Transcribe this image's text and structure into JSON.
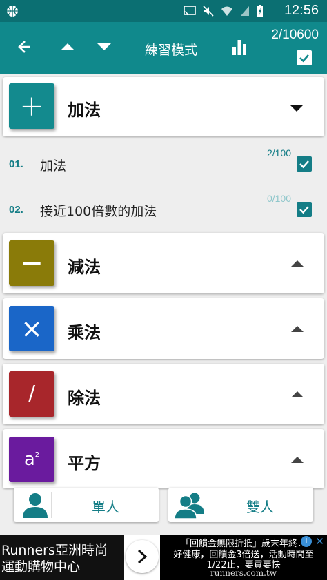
{
  "status_bar": {
    "time": "12:56",
    "icons": [
      "basketball-icon",
      "cast-icon",
      "mute-icon",
      "wifi-icon",
      "signal-icon",
      "battery-charging-icon"
    ]
  },
  "app_bar": {
    "title": "練習模式",
    "counter": "2/10600",
    "select_all_checked": true,
    "buttons": [
      "back-icon",
      "move-up-icon",
      "move-down-icon",
      "stats-icon"
    ]
  },
  "categories": [
    {
      "title": "加法",
      "symbol": "+",
      "color": "#138a8e",
      "expanded": true,
      "items": [
        {
          "num": "01.",
          "label": "加法",
          "progress": "2/100",
          "checked": true
        },
        {
          "num": "02.",
          "label": "接近100倍數的加法",
          "progress": "0/100",
          "checked": true
        }
      ]
    },
    {
      "title": "減法",
      "symbol": "−",
      "color": "#8a7b09",
      "expanded": false
    },
    {
      "title": "乘法",
      "symbol": "×",
      "color": "#1a66c8",
      "expanded": false
    },
    {
      "title": "除法",
      "symbol": "/",
      "color": "#a8262b",
      "expanded": false
    },
    {
      "title": "平方",
      "symbol": "a",
      "symbol_sup": "2",
      "color": "#6a1b9e",
      "expanded": false
    }
  ],
  "colors": {
    "status_bar": "#0b6f72",
    "app_bar": "#10898c",
    "accent": "#147d86",
    "progress_done": "#147d86",
    "progress_zero": "#8fc7cb"
  },
  "modes": [
    {
      "label": "單人",
      "icon": "single-player-icon"
    },
    {
      "label": "雙人",
      "icon": "two-players-icon"
    }
  ],
  "ad": {
    "left_line1": "Runners亞洲時尚",
    "left_line2": "運動購物中心",
    "right_line1": "「回饋金無限折抵」歲末年終．",
    "right_line2": "好健康，回饋金3倍送，活動時間至",
    "right_line3": "1/22止，要買要快",
    "url": "runners.com.tw",
    "info_symbol": "i",
    "close_symbol": "✕"
  }
}
